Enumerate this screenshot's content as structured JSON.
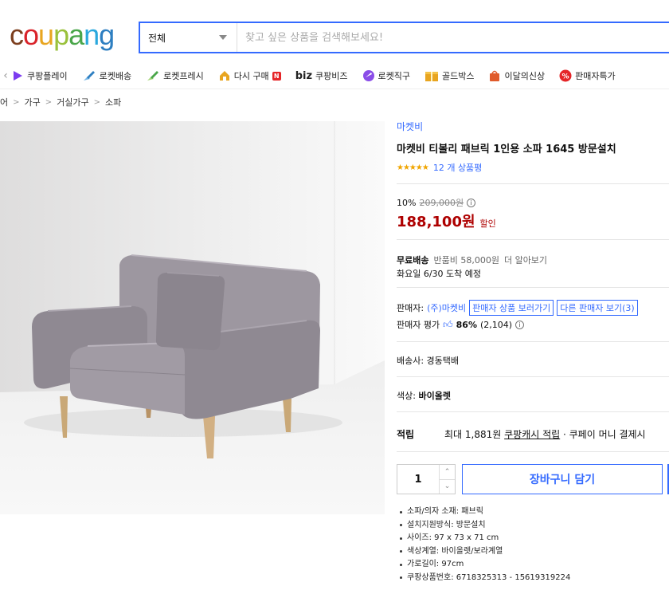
{
  "logo": {
    "text": "coupang",
    "letters": [
      {
        "ch": "c",
        "color": "#7d3f1f"
      },
      {
        "ch": "o",
        "color": "#d9232a"
      },
      {
        "ch": "u",
        "color": "#e8a520"
      },
      {
        "ch": "p",
        "color": "#9ac13c"
      },
      {
        "ch": "a",
        "color": "#4aa64a"
      },
      {
        "ch": "n",
        "color": "#2aa8dd"
      },
      {
        "ch": "g",
        "color": "#2e7fc1"
      }
    ]
  },
  "search": {
    "category": "전체",
    "placeholder": "찾고 싶은 상품을 검색해보세요!"
  },
  "nav": {
    "items": [
      {
        "label": "쿠팡플레이",
        "icon": "play-icon",
        "color": "#7c3cf0"
      },
      {
        "label": "로켓배송",
        "icon": "rocket-icon",
        "color": "#2e7fc1"
      },
      {
        "label": "로켓프레시",
        "icon": "fresh-rocket-icon",
        "color": "#4aa64a"
      },
      {
        "label": "다시 구매",
        "icon": "home-icon",
        "color": "#e8a520",
        "badge": "N"
      },
      {
        "label": "쿠팡비즈",
        "icon": "biz-logo",
        "prefix": "biz"
      },
      {
        "label": "로켓직구",
        "icon": "globe-icon",
        "color": "#8a4de8"
      },
      {
        "label": "골드박스",
        "icon": "gift-icon",
        "color": "#e8a520"
      },
      {
        "label": "이달의신상",
        "icon": "bag-icon",
        "color": "#e05a2a"
      },
      {
        "label": "판매자특가",
        "icon": "percent-badge-icon",
        "color": "#e52528"
      }
    ]
  },
  "breadcrumb": [
    "어",
    "가구",
    "거실가구",
    "소파"
  ],
  "product": {
    "brand": "마켓비",
    "title": "마켓비 티볼리 패브릭 1인용 소파 1645 방문설치",
    "rating": 5,
    "stars": "★★★★★",
    "review_count": "12 개 상품평",
    "discount_rate": "10%",
    "original_price": "209,000원",
    "price": "188,100원",
    "price_tag": "할인",
    "shipping_label": "무료배송",
    "return_fee": "반품비 58,000원",
    "more": "더 알아보기",
    "arrival": "화요일 6/30 도착 예정",
    "seller_label": "판매자:",
    "seller_name": "(주)마켓비",
    "seller_products_btn": "판매자 상품 보러가기",
    "other_sellers_btn": "다른 판매자 보기(3)",
    "seller_score_label": "판매자 평가",
    "seller_score": "86%",
    "seller_score_count": "(2,104)",
    "carrier": "배송사:  경동택배",
    "color_label": "색상:",
    "color_value": "바이올렛",
    "points_label": "적립",
    "points_text": "최대 1,881원",
    "points_link": "쿠팡캐시 적립",
    "points_tail": "· 쿠페이 머니 결제시",
    "quantity": "1",
    "cart_button": "장바구니 담기",
    "specs": [
      "소파/의자 소재: 패브릭",
      "설치지원방식: 방문설치",
      "사이즈: 97 x 73 x 71 cm",
      "색상계열: 바이올렛/보라계열",
      "가로길이: 97cm",
      "쿠팡상품번호: 6718325313 - 15619319224"
    ]
  },
  "colors": {
    "accent": "#346aff",
    "price": "#ae0000",
    "sofa": "#8f8992"
  }
}
